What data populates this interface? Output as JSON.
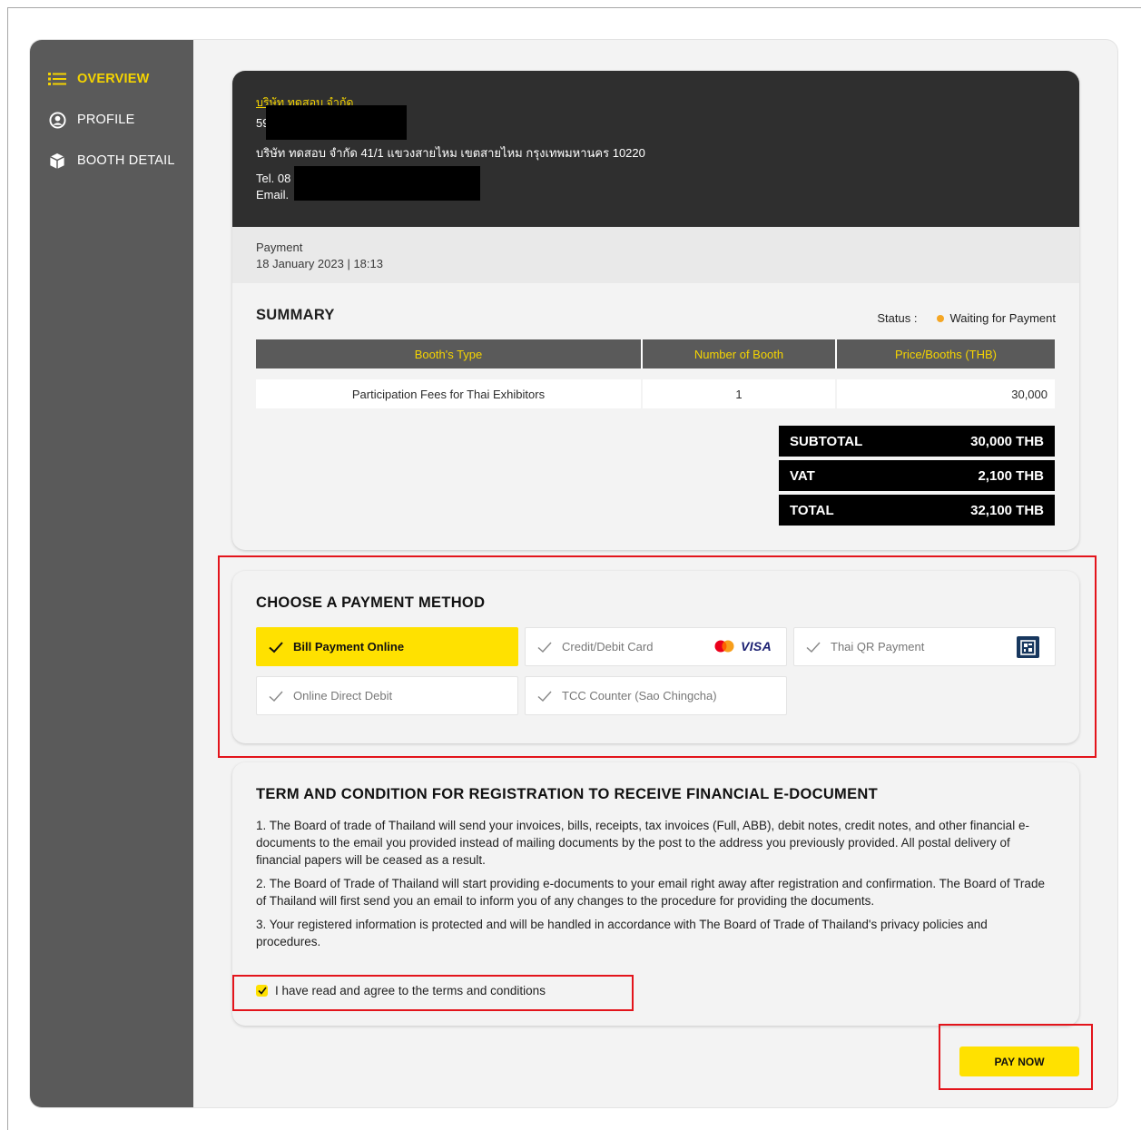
{
  "sidebar": {
    "items": [
      {
        "label": "OVERVIEW",
        "icon": "list-icon",
        "active": true
      },
      {
        "label": "PROFILE",
        "icon": "user-circle-icon",
        "active": false
      },
      {
        "label": "BOOTH DETAIL",
        "icon": "booth-cube-icon",
        "active": false
      }
    ]
  },
  "company": {
    "name": "บริษัท ทดสอบ จำกัด",
    "code_prefix": "59",
    "address": "บริษัท ทดสอบ จำกัด 41/1 แขวงสายไหม เขตสายไหม กรุงเทพมหานคร 10220",
    "tel_label": "Tel. 08",
    "email_label": "Email."
  },
  "payment": {
    "label": "Payment",
    "datetime": "18 January 2023 | 18:13"
  },
  "summary": {
    "title": "SUMMARY",
    "status_label": "Status :",
    "status_value": "Waiting for Payment",
    "status_color": "#f5a623",
    "columns": [
      "Booth's Type",
      "Number of Booth",
      "Price/Booths (THB)"
    ],
    "rows": [
      {
        "type": "Participation Fees for Thai Exhibitors",
        "count": "1",
        "price": "30,000"
      }
    ],
    "totals": [
      {
        "label": "SUBTOTAL",
        "value": "30,000 THB"
      },
      {
        "label": "VAT",
        "value": "2,100 THB"
      },
      {
        "label": "TOTAL",
        "value": "32,100 THB"
      }
    ]
  },
  "payment_method": {
    "title": "CHOOSE A PAYMENT METHOD",
    "options": [
      {
        "label": "Bill Payment Online",
        "selected": true
      },
      {
        "label": "Credit/Debit Card",
        "selected": false,
        "logos": [
          "mastercard-icon",
          "VISA"
        ]
      },
      {
        "label": "Thai QR Payment",
        "selected": false,
        "logos": [
          "thai-qr-icon"
        ]
      },
      {
        "label": "Online Direct Debit",
        "selected": false
      },
      {
        "label": "TCC Counter (Sao Chingcha)",
        "selected": false
      }
    ]
  },
  "terms": {
    "title": "TERM AND CONDITION FOR REGISTRATION TO RECEIVE FINANCIAL E-DOCUMENT",
    "paragraphs": [
      "1. The Board of trade of Thailand will send your invoices, bills, receipts, tax invoices (Full, ABB), debit notes, credit notes, and other financial e-documents to the email you provided instead of mailing documents by the post to the address you previously provided. All postal delivery of financial papers will be ceased as a result.",
      "2. The Board of Trade of Thailand will start providing e-documents to your email right away after registration and confirmation. The Board of Trade of Thailand will first send you an email to inform you of any changes to the procedure for providing the documents.",
      "3. Your registered information is protected and will be handled in accordance with The Board of Trade of Thailand's privacy policies and procedures."
    ],
    "agree_label": "I have read and agree to the terms and conditions",
    "agree_checked": true
  },
  "actions": {
    "pay_now_label": "PAY NOW"
  },
  "colors": {
    "accent": "#ffe100",
    "sidebar": "#5a5a5a",
    "highlight": "#e3141b"
  }
}
